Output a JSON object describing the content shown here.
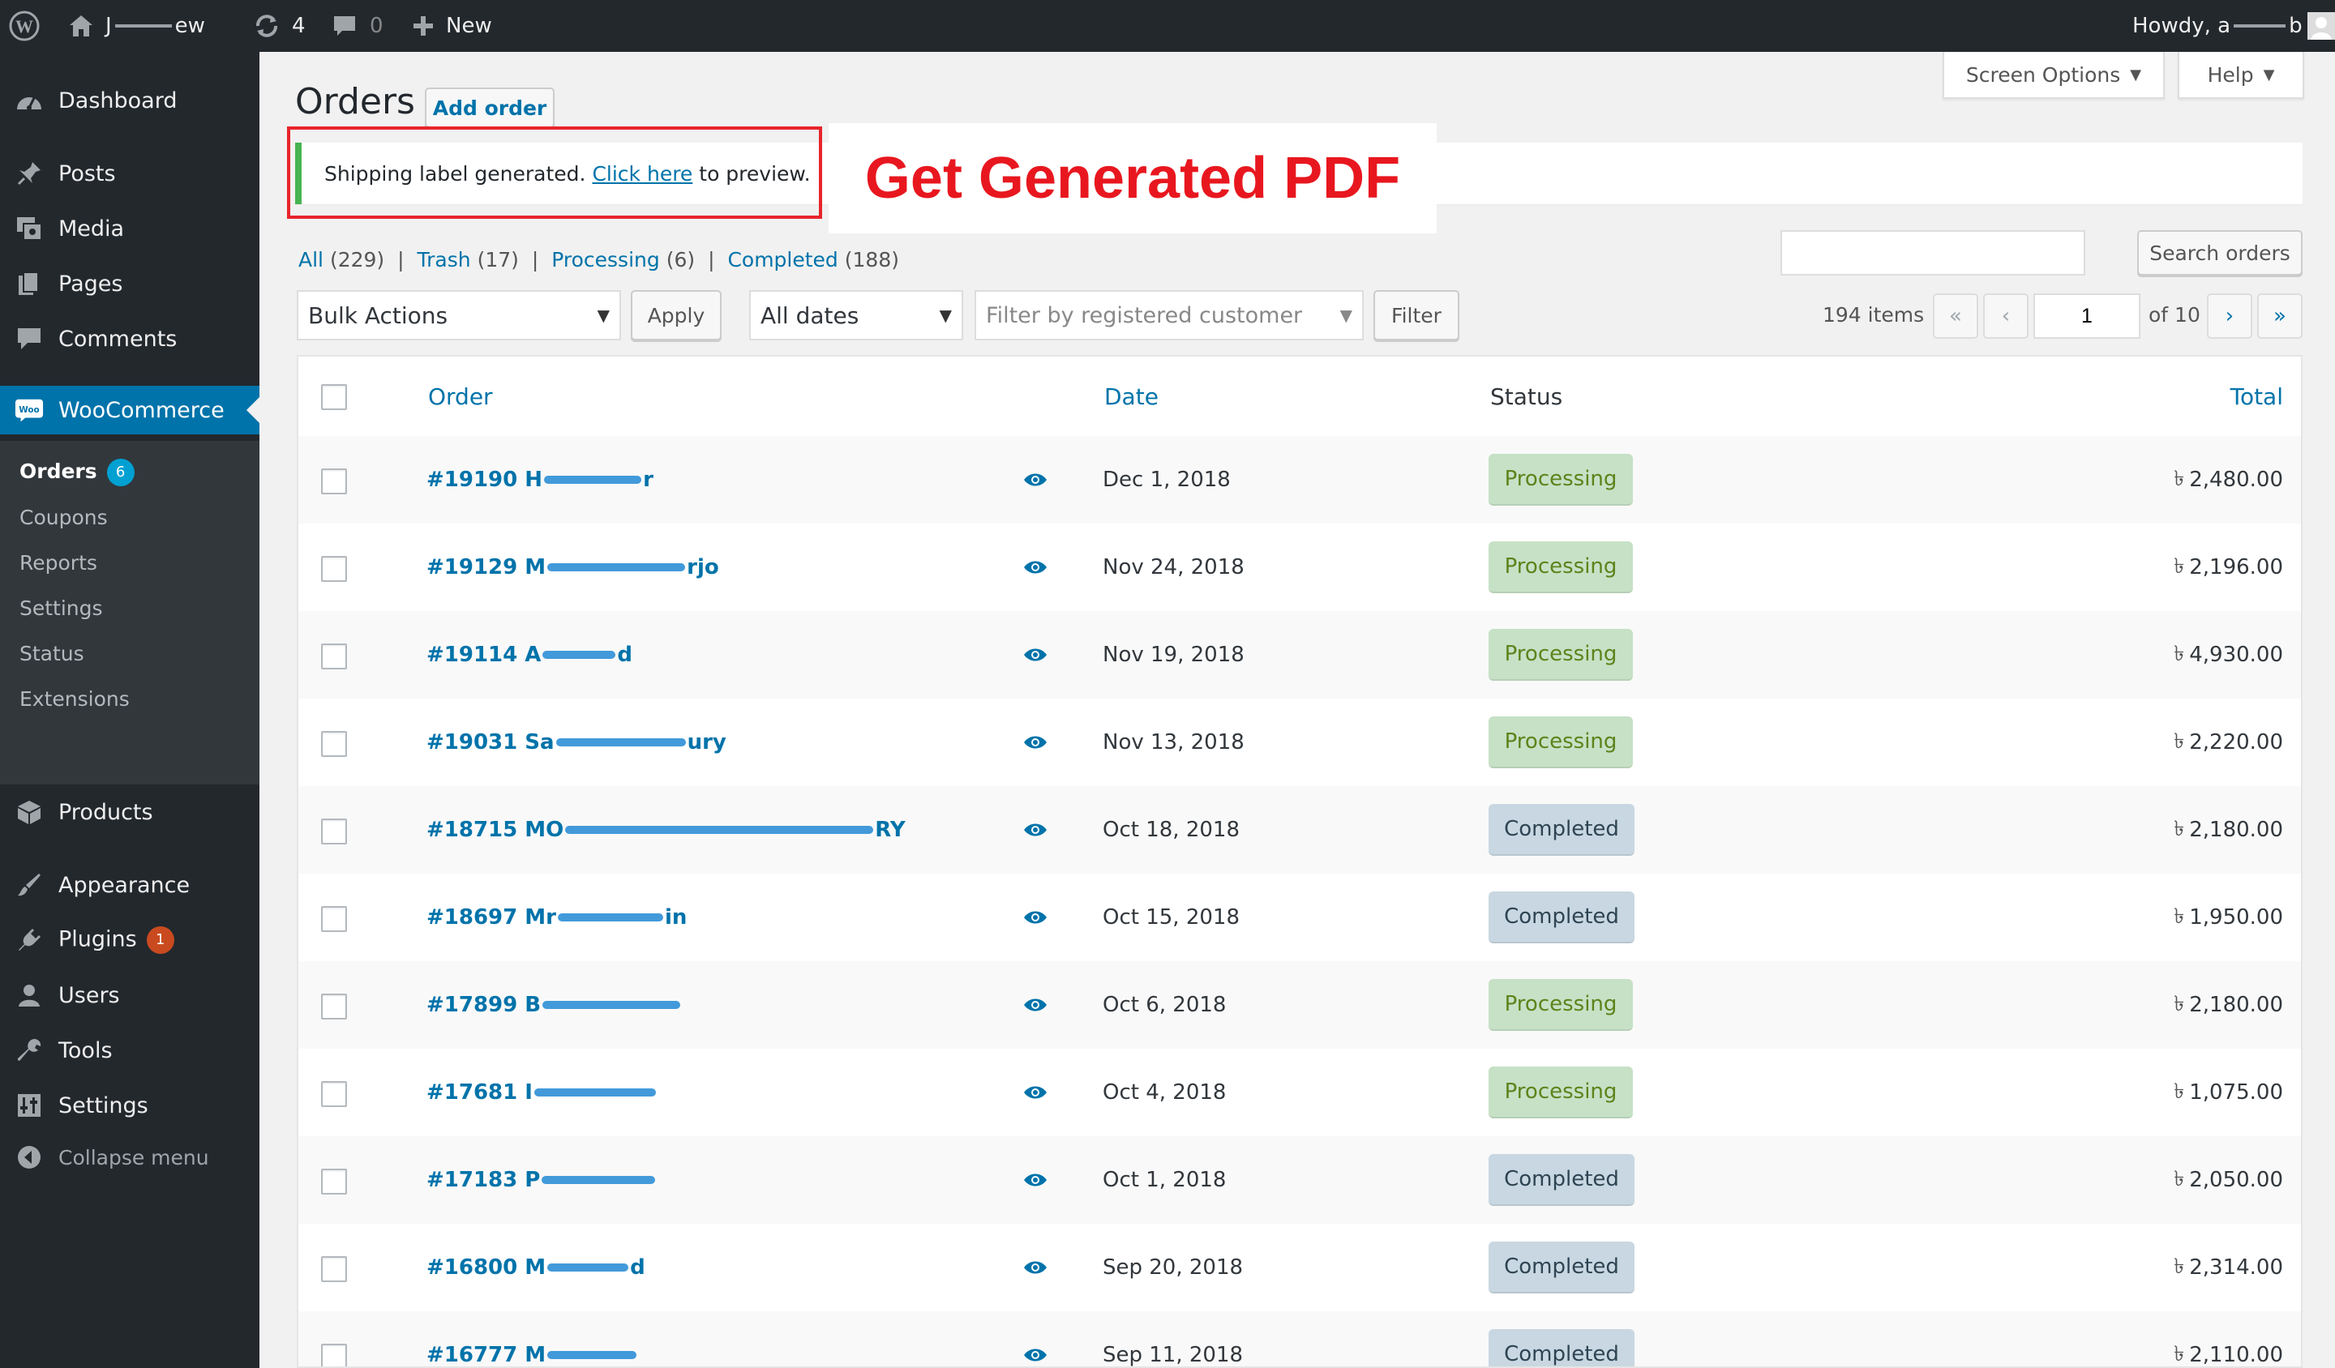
{
  "admin_bar": {
    "site_name_start": "J",
    "site_name_end": "ew",
    "updates_count": "4",
    "comments_count": "0",
    "new_label": "New",
    "howdy_text": "Howdy, a",
    "howdy_end": "b"
  },
  "sidebar": {
    "menu": [
      {
        "label": "Dashboard",
        "icon": "dashboard-icon"
      },
      {
        "label": "Posts",
        "icon": "pin-icon"
      },
      {
        "label": "Media",
        "icon": "media-icon"
      },
      {
        "label": "Pages",
        "icon": "pages-icon"
      },
      {
        "label": "Comments",
        "icon": "comment-icon"
      },
      {
        "label": "WooCommerce",
        "icon": "woo-icon"
      },
      {
        "label": "Products",
        "icon": "box-icon"
      },
      {
        "label": "Appearance",
        "icon": "brush-icon"
      },
      {
        "label": "Plugins",
        "icon": "plug-icon",
        "badge": "1"
      },
      {
        "label": "Users",
        "icon": "user-icon"
      },
      {
        "label": "Tools",
        "icon": "wrench-icon"
      },
      {
        "label": "Settings",
        "icon": "settings-icon"
      },
      {
        "label": "Collapse menu",
        "icon": "collapse-icon"
      }
    ],
    "woocommerce_submenu": [
      {
        "label": "Orders",
        "badge": "6"
      },
      {
        "label": "Coupons"
      },
      {
        "label": "Reports"
      },
      {
        "label": "Settings"
      },
      {
        "label": "Status"
      },
      {
        "label": "Extensions"
      }
    ]
  },
  "header": {
    "screen_options": "Screen Options",
    "help": "Help",
    "page_title": "Orders",
    "add_order": "Add order"
  },
  "notice": {
    "text_before": "Shipping label generated.",
    "link_text": "Click here",
    "text_after": "to preview."
  },
  "annotation": {
    "text": "Get Generated PDF",
    "color": "#e8171f"
  },
  "filters": {
    "views": [
      {
        "label": "All",
        "count": "(229)"
      },
      {
        "label": "Trash",
        "count": "(17)"
      },
      {
        "label": "Processing",
        "count": "(6)"
      },
      {
        "label": "Completed",
        "count": "(188)"
      }
    ],
    "search_value": "",
    "search_button": "Search orders",
    "bulk_actions": "Bulk Actions",
    "apply": "Apply",
    "all_dates": "All dates",
    "customer_placeholder": "Filter by registered customer",
    "filter_button": "Filter"
  },
  "pagination": {
    "items": "194 items",
    "first": "«",
    "prev": "‹",
    "current_page": "1",
    "of_pages": "of 10",
    "next": "›",
    "last": "»"
  },
  "table": {
    "columns": {
      "order": "Order",
      "date": "Date",
      "status": "Status",
      "total": "Total"
    },
    "rows": [
      {
        "order": "#19190 H",
        "suffix": "r",
        "date": "Dec 1, 2018",
        "status": "Processing",
        "total": "2,480.00"
      },
      {
        "order": "#19129 M",
        "suffix": "rjo",
        "date": "Nov 24, 2018",
        "status": "Processing",
        "total": "2,196.00"
      },
      {
        "order": "#19114 A",
        "suffix": "d",
        "date": "Nov 19, 2018",
        "status": "Processing",
        "total": "4,930.00"
      },
      {
        "order": "#19031 Sa",
        "suffix": "ury",
        "date": "Nov 13, 2018",
        "status": "Processing",
        "total": "2,220.00"
      },
      {
        "order": "#18715 MO",
        "suffix": "RY",
        "date": "Oct 18, 2018",
        "status": "Completed",
        "total": "2,180.00"
      },
      {
        "order": "#18697 Mr",
        "suffix": "in",
        "date": "Oct 15, 2018",
        "status": "Completed",
        "total": "1,950.00"
      },
      {
        "order": "#17899 B",
        "suffix": "",
        "date": "Oct 6, 2018",
        "status": "Processing",
        "total": "2,180.00"
      },
      {
        "order": "#17681 I",
        "suffix": "",
        "date": "Oct 4, 2018",
        "status": "Processing",
        "total": "1,075.00"
      },
      {
        "order": "#17183 P",
        "suffix": "",
        "date": "Oct 1, 2018",
        "status": "Completed",
        "total": "2,050.00"
      },
      {
        "order": "#16800 M",
        "suffix": "d",
        "date": "Sep 20, 2018",
        "status": "Completed",
        "total": "2,314.00"
      },
      {
        "order": "#16777 M",
        "suffix": "",
        "date": "Sep 11, 2018",
        "status": "Completed",
        "total": "2,110.00"
      }
    ],
    "currency_symbol": "৳"
  },
  "colors": {
    "admin_bar": "#23282d",
    "accent": "#0073aa",
    "processing_bg": "#c6e1c6",
    "completed_bg": "#c8d7e1",
    "notice_border": "#46b450"
  }
}
